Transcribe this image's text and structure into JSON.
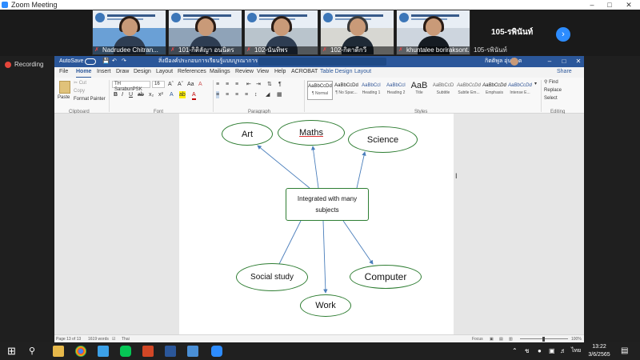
{
  "zoom": {
    "window_title": "Zoom Meeting",
    "participants": [
      {
        "name": "Nadrudee Chitran..."
      },
      {
        "name": "101-กิติลัญา อนนิตร"
      },
      {
        "name": "102-นันทิพร"
      },
      {
        "name": "102-กิตาดีกวี"
      },
      {
        "name": "khuntalee boriraksont..."
      }
    ],
    "extra_tile_label": "105-รพินันท์",
    "extra_tile_sublabel": "105-รพินันท์",
    "next_icon": "chevron-right-icon",
    "recording_label": "Recording"
  },
  "word": {
    "autosave_label": "AutoSave",
    "doc_title": "สิ่งมีองค์ประกอบการเรียนรู้แบบบูรณาการ - Word",
    "user_name": "กิตติพูล อุ่นจิตต",
    "tabs": [
      "File",
      "Home",
      "Insert",
      "Draw",
      "Design",
      "Layout",
      "References",
      "Mailings",
      "Review",
      "View",
      "Help",
      "ACROBAT",
      "Table Design",
      "Layout"
    ],
    "active_tab": "Home",
    "share_label": "Share",
    "ribbon": {
      "paste_label": "Paste",
      "cut_label": "Cut",
      "copy_label": "Copy",
      "format_painter_label": "Format Painter",
      "clipboard_group": "Clipboard",
      "font_name": "TH SarabunPSK",
      "font_size": "16",
      "font_group": "Font",
      "paragraph_group": "Paragraph",
      "styles_group": "Styles",
      "editing_group": "Editing",
      "find_label": "Find",
      "replace_label": "Replace",
      "select_label": "Select",
      "styles": [
        {
          "sample": "AaBbCcDd",
          "label": "¶ Normal"
        },
        {
          "sample": "AaBbCcDd",
          "label": "¶ No Spac..."
        },
        {
          "sample": "AaBbCcI",
          "label": "Heading 1"
        },
        {
          "sample": "AaBbCcI",
          "label": "Heading 2"
        },
        {
          "sample": "AaB",
          "label": "Title"
        },
        {
          "sample": "AaBbCcD",
          "label": "Subtitle"
        },
        {
          "sample": "AaBbCcDd",
          "label": "Subtle Em..."
        },
        {
          "sample": "AaBbCcDd",
          "label": "Emphasis"
        },
        {
          "sample": "AaBbCcDd",
          "label": "Intense E..."
        }
      ]
    },
    "diagram": {
      "center": "Integrated with many subjects",
      "art": "Art",
      "maths": "Maths",
      "science": "Science",
      "social": "Social study",
      "computer": "Computer",
      "work": "Work"
    },
    "status": {
      "page": "Page 13 of 13",
      "words": "1619 words",
      "lang": "Thai",
      "focus": "Focus",
      "zoom": "100%"
    }
  },
  "taskbar": {
    "time": "13:22",
    "date": "3/6/2565",
    "lang": "ไทย",
    "keyboard": "ENG"
  }
}
